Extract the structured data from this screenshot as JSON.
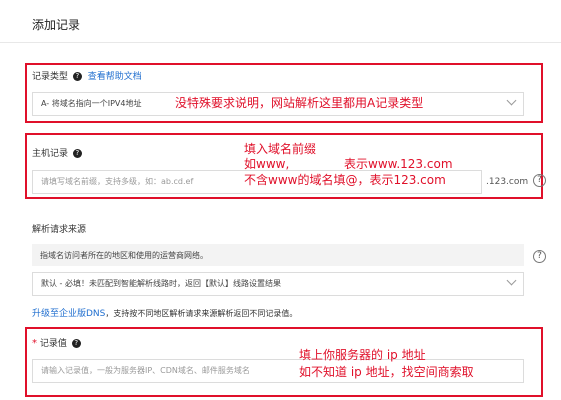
{
  "page": {
    "title": "添加记录"
  },
  "record_type": {
    "label": "记录类型",
    "help_link": "查看帮助文档",
    "value": "A- 将域名指向一个IPV4地址",
    "annotation": "没特殊要求说明，网站解析这里都用A记录类型"
  },
  "host_record": {
    "label": "主机记录",
    "placeholder": "请填写域名前缀，支持多级，如：ab.cd.ef",
    "suffix": ".123.com",
    "annotation": {
      "line1": "填入域名前缀",
      "line2a": "如www,",
      "line2b": "表示www.123.com",
      "line3": "不含www的域名填@，表示123.com"
    }
  },
  "resolve_source": {
    "label": "解析请求来源",
    "description": "指域名访问者所在的地区和使用的运营商网络。",
    "select_value": "默认 - 必填！未匹配到智能解析线路时，返回【默认】线路设置结果",
    "upgrade_link": "升级至企业版DNS",
    "upgrade_text": "，支持按不同地区解析请求来源解析返回不同记录值。"
  },
  "record_value": {
    "required_mark": "*",
    "label": "记录值",
    "placeholder": "请输入记录值，一般为服务器IP、CDN域名、邮件服务域名",
    "annotation": {
      "line1": "填上你服务器的 ip 地址",
      "line2": "如不知道 ip 地址，找空间商索取"
    }
  },
  "colors": {
    "annotation_red": "#e0102a",
    "link_blue": "#1f6ecf"
  }
}
